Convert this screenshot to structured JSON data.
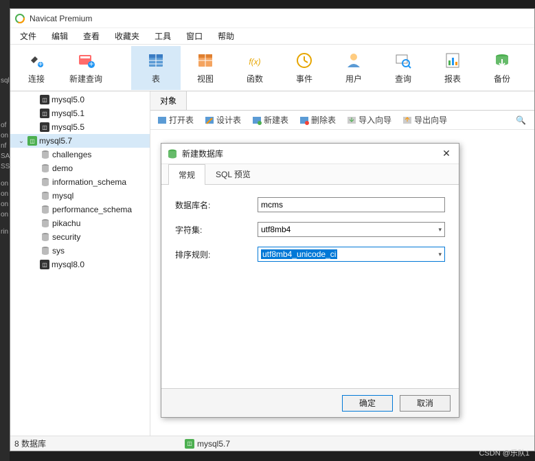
{
  "window": {
    "title": "Navicat Premium"
  },
  "menubar": {
    "items": [
      "文件",
      "编辑",
      "查看",
      "收藏夹",
      "工具",
      "窗口",
      "帮助"
    ]
  },
  "toolbar": {
    "items": [
      {
        "label": "连接",
        "icon": "plug"
      },
      {
        "label": "新建查询",
        "icon": "new-query"
      },
      {
        "label": "表",
        "icon": "table",
        "active": true
      },
      {
        "label": "视图",
        "icon": "view"
      },
      {
        "label": "函数",
        "icon": "fx"
      },
      {
        "label": "事件",
        "icon": "event"
      },
      {
        "label": "用户",
        "icon": "user"
      },
      {
        "label": "查询",
        "icon": "query"
      },
      {
        "label": "报表",
        "icon": "report"
      },
      {
        "label": "备份",
        "icon": "backup"
      }
    ]
  },
  "sidebar": {
    "connections": [
      {
        "label": "mysql5.0",
        "active": false
      },
      {
        "label": "mysql5.1",
        "active": false
      },
      {
        "label": "mysql5.5",
        "active": false
      },
      {
        "label": "mysql5.7",
        "active": true,
        "expanded": true,
        "databases": [
          "challenges",
          "demo",
          "information_schema",
          "mysql",
          "performance_schema",
          "pikachu",
          "security",
          "sys"
        ]
      },
      {
        "label": "mysql8.0",
        "active": false
      }
    ]
  },
  "content": {
    "tab": "对象",
    "toolbar_items": [
      "打开表",
      "设计表",
      "新建表",
      "删除表",
      "导入向导",
      "导出向导"
    ]
  },
  "dialog": {
    "title": "新建数据库",
    "tabs": [
      "常规",
      "SQL 预览"
    ],
    "form": {
      "db_name_label": "数据库名:",
      "db_name_value": "mcms",
      "charset_label": "字符集:",
      "charset_value": "utf8mb4",
      "collation_label": "排序规则:",
      "collation_value": "utf8mb4_unicode_ci"
    },
    "buttons": {
      "ok": "确定",
      "cancel": "取消"
    }
  },
  "status": {
    "left": "8 数据库",
    "mid": "mysql5.7",
    "credit": "CSDN @乐队1"
  }
}
